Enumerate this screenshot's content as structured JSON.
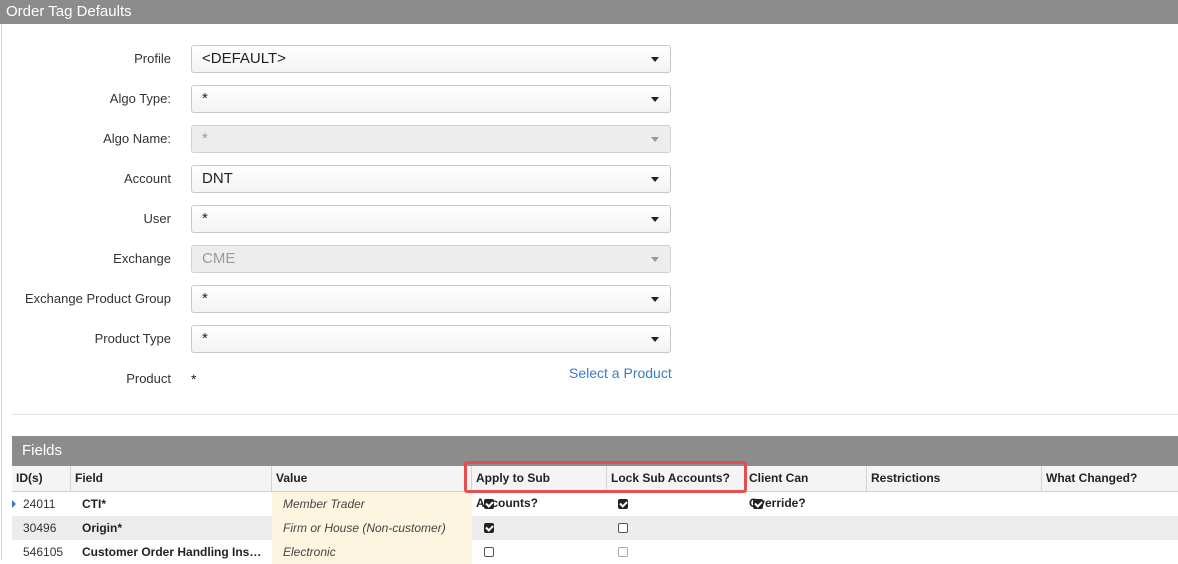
{
  "window": {
    "title": "Order Tag Defaults"
  },
  "form": {
    "profile": {
      "label": "Profile",
      "value": "<DEFAULT>"
    },
    "algo_type": {
      "label": "Algo Type:",
      "value": "*"
    },
    "algo_name": {
      "label": "Algo Name:",
      "value": "*"
    },
    "account": {
      "label": "Account",
      "value": "DNT"
    },
    "user": {
      "label": "User",
      "value": "*"
    },
    "exchange": {
      "label": "Exchange",
      "value": "CME"
    },
    "exchange_product_group": {
      "label": "Exchange Product Group",
      "value": "*"
    },
    "product_type": {
      "label": "Product Type",
      "value": "*"
    },
    "product": {
      "label": "Product",
      "value": "*",
      "link": "Select a Product"
    }
  },
  "fields": {
    "title": "Fields",
    "columns": [
      "ID(s)",
      "Field",
      "Value",
      "Apply to Sub Accounts?",
      "Lock Sub Accounts?",
      "Client Can Override?",
      "Restrictions",
      "What Changed?"
    ],
    "rows": [
      {
        "id": "24011",
        "field": "CTI*",
        "value": "Member Trader",
        "apply": true,
        "lock": true,
        "override": true
      },
      {
        "id": "30496",
        "field": "Origin*",
        "value": "Firm or House (Non-customer)",
        "apply": true,
        "lock": false,
        "override": null
      },
      {
        "id": "546105",
        "field": "Customer Order Handling Ins…",
        "value": "Electronic",
        "apply": false,
        "lock": false,
        "override": null
      }
    ]
  },
  "colors": {
    "header_gray": "#8c8c8c",
    "link_blue": "#3a7dc2",
    "highlight_red": "#e05050",
    "value_bg": "#fdf5df"
  }
}
